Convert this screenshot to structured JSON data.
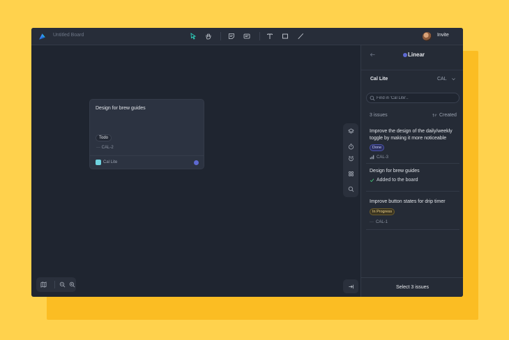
{
  "topbar": {
    "board_title": "Untitled Board",
    "invite_label": "Invite",
    "tools": [
      "select-icon",
      "hand-icon",
      "sticky-note-icon",
      "card-icon",
      "text-icon",
      "rectangle-icon",
      "line-icon"
    ]
  },
  "card": {
    "title": "Design for brew guides",
    "status": "Todo",
    "issue_id": "CAL-2",
    "project": "Cal Lite"
  },
  "side_tools": [
    "layers-icon",
    "timer-icon",
    "alarm-icon",
    "apps-icon",
    "search-icon"
  ],
  "bottom_tools": [
    "map-icon",
    "zoom-out-icon",
    "zoom-in-icon",
    "collapse-panel-icon"
  ],
  "panel": {
    "title": "Linear",
    "team_name": "Cal Lite",
    "team_key": "CAL",
    "search_placeholder": "Find in 'Cal Lite'..",
    "issue_count": "3 issues",
    "sort_label": "Created",
    "issues": [
      {
        "title": "Improve the design of the daily/weekly toggle by making it more noticeable",
        "status": "Done",
        "id": "CAL-3"
      },
      {
        "title": "Design for brew guides",
        "added_label": "Added to the board"
      },
      {
        "title": "Improve button states for drip timer",
        "status": "In Progress",
        "id": "CAL-1"
      }
    ],
    "footer_label": "Select 3 issues"
  },
  "colors": {
    "background": "#FFD24D",
    "accent_linear": "#5E6AD2"
  }
}
